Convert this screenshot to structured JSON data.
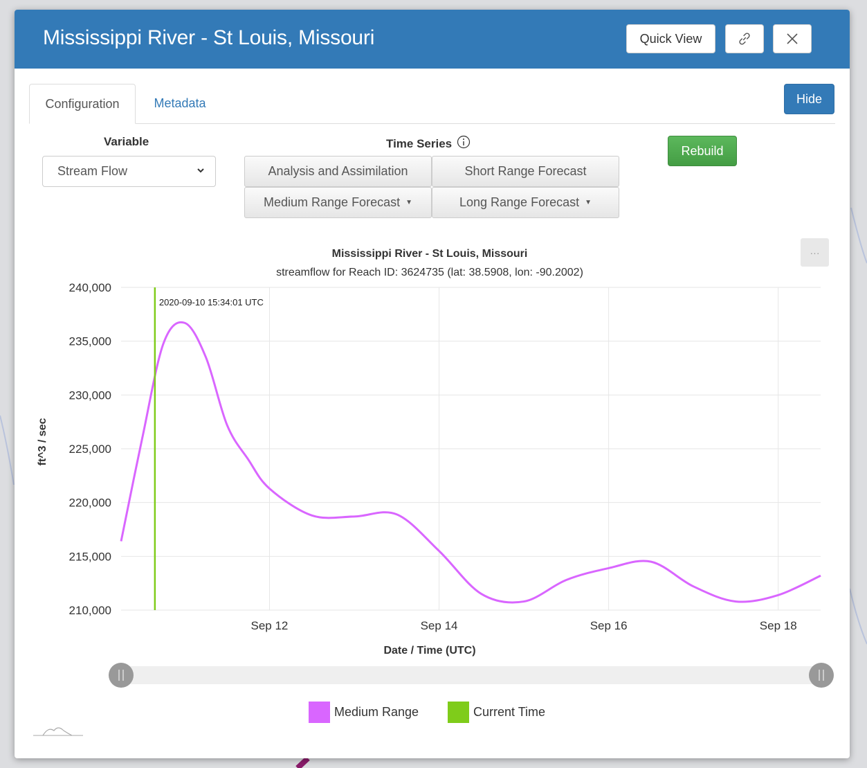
{
  "header": {
    "title": "Mississippi River - St Louis, Missouri",
    "quick_view_label": "Quick View",
    "link_icon": "link-icon",
    "close_icon": "close-icon"
  },
  "tabs": [
    {
      "label": "Configuration",
      "active": true
    },
    {
      "label": "Metadata",
      "active": false
    }
  ],
  "hide_label": "Hide",
  "variable": {
    "label": "Variable",
    "selected": "Stream Flow"
  },
  "time_series": {
    "label": "Time Series",
    "info_icon": "info-icon",
    "buttons": {
      "analysis": "Analysis and Assimilation",
      "short": "Short Range Forecast",
      "medium": "Medium Range Forecast",
      "long": "Long Range Forecast"
    }
  },
  "rebuild_label": "Rebuild",
  "colors": {
    "header": "#337ab7",
    "medium_range": "#d966ff",
    "current_time": "#7fcc1a",
    "rebuild": "#5cb85c"
  },
  "chart_data": {
    "type": "line",
    "title": "Mississippi River - St Louis, Missouri",
    "subtitle": "streamflow for Reach ID: 3624735 (lat: 38.5908, lon: -90.2002)",
    "xlabel": "Date / Time (UTC)",
    "ylabel": "ft^3 / sec",
    "ylim": [
      210000,
      240000
    ],
    "xlim": [
      "2020-09-10 06:00",
      "2020-09-18 12:00"
    ],
    "y_ticks": [
      "240,000",
      "235,000",
      "230,000",
      "225,000",
      "220,000",
      "215,000",
      "210,000"
    ],
    "x_ticks": [
      "Sep 12",
      "Sep 14",
      "Sep 16",
      "Sep 18"
    ],
    "grid": true,
    "legend_position": "bottom",
    "series": [
      {
        "name": "Medium Range",
        "color": "#d966ff",
        "x": [
          "2020-09-10 06:00",
          "2020-09-10 12:00",
          "2020-09-10 18:00",
          "2020-09-11 00:00",
          "2020-09-11 06:00",
          "2020-09-11 12:00",
          "2020-09-11 18:00",
          "2020-09-12 00:00",
          "2020-09-12 12:00",
          "2020-09-13 00:00",
          "2020-09-13 12:00",
          "2020-09-14 00:00",
          "2020-09-14 12:00",
          "2020-09-15 00:00",
          "2020-09-15 12:00",
          "2020-09-16 00:00",
          "2020-09-16 12:00",
          "2020-09-17 00:00",
          "2020-09-17 12:00",
          "2020-09-18 00:00",
          "2020-09-18 12:00"
        ],
        "values": [
          216400,
          226000,
          234800,
          236700,
          233500,
          227200,
          224000,
          221300,
          218800,
          218700,
          218900,
          215500,
          211500,
          210800,
          212800,
          213900,
          214500,
          212200,
          210800,
          211400,
          213200
        ]
      }
    ],
    "current_time": {
      "name": "Current Time",
      "x": "2020-09-10 15:34",
      "label": "2020-09-10 15:34:01 UTC",
      "color": "#7fcc1a"
    },
    "range_slider": true
  }
}
